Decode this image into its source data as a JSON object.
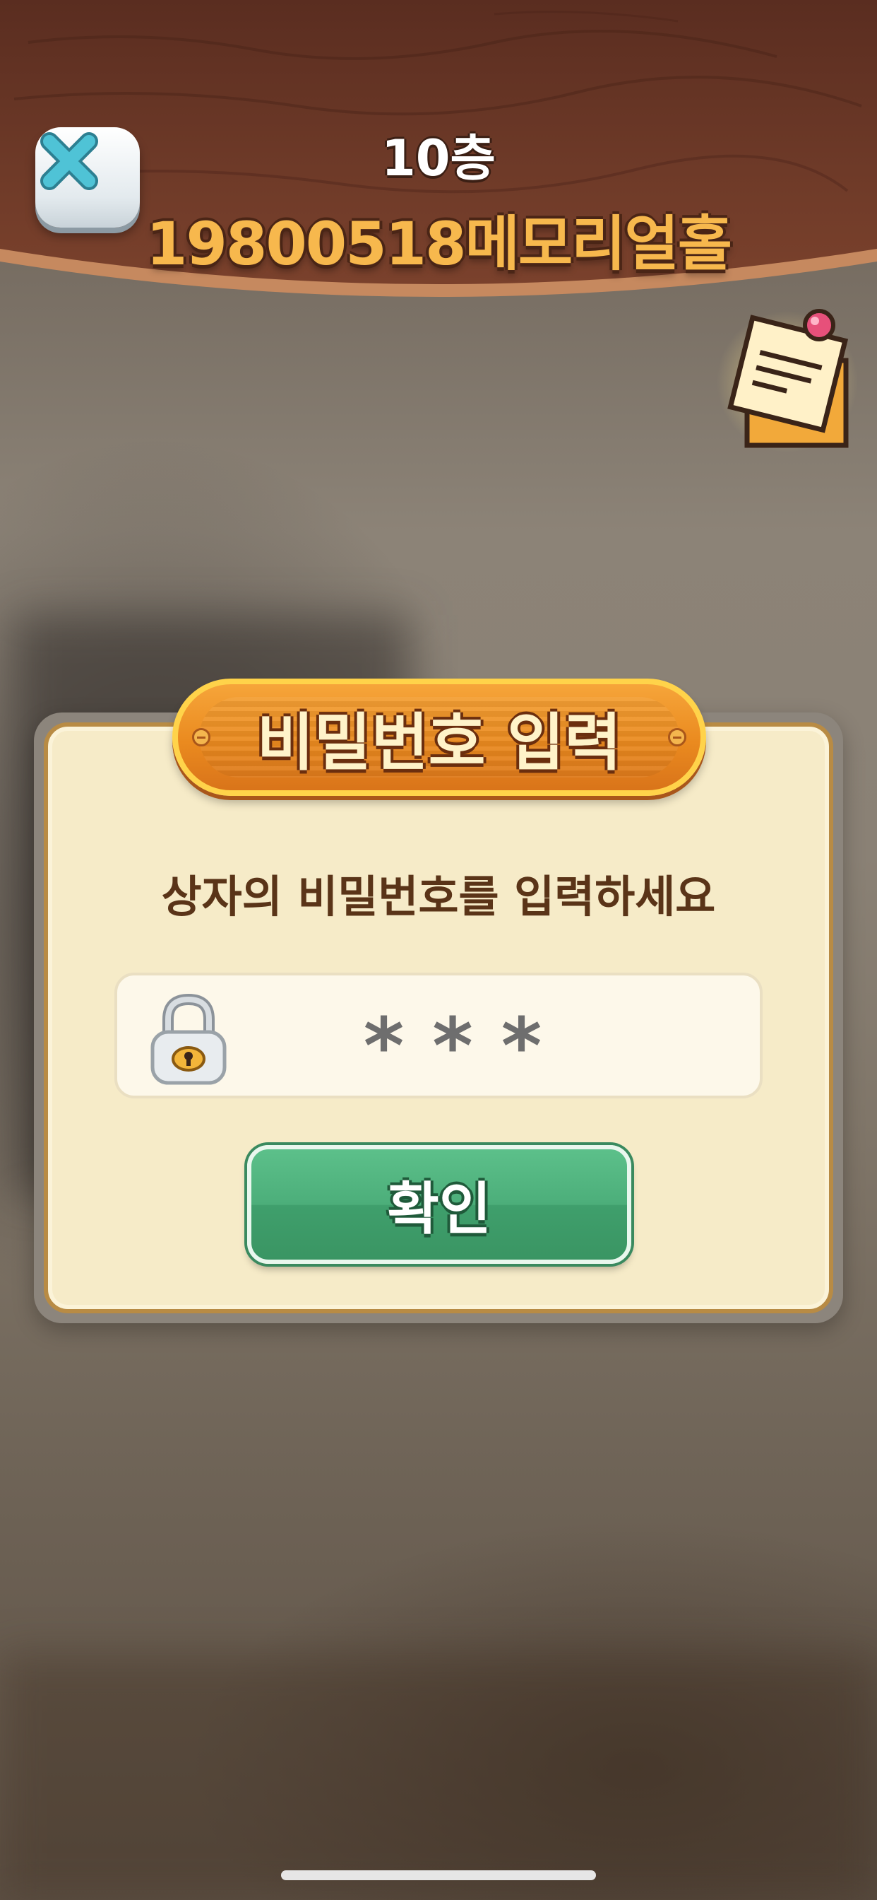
{
  "header": {
    "floor": "10층",
    "place": "19800518메모리얼홀",
    "close_icon": "close-x-icon",
    "memo_icon": "memo-note-icon"
  },
  "dialog": {
    "title": "비밀번호 입력",
    "prompt": "상자의 비밀번호를 입력하세요",
    "password_value": "***",
    "lock_icon": "padlock-icon",
    "confirm_label": "확인"
  },
  "colors": {
    "header_wood": "#6b3626",
    "title_plate": "#ea8a1f",
    "dialog_bg": "#f6ebc8",
    "confirm_green": "#4cae7a",
    "place_text": "#f7b84d"
  }
}
